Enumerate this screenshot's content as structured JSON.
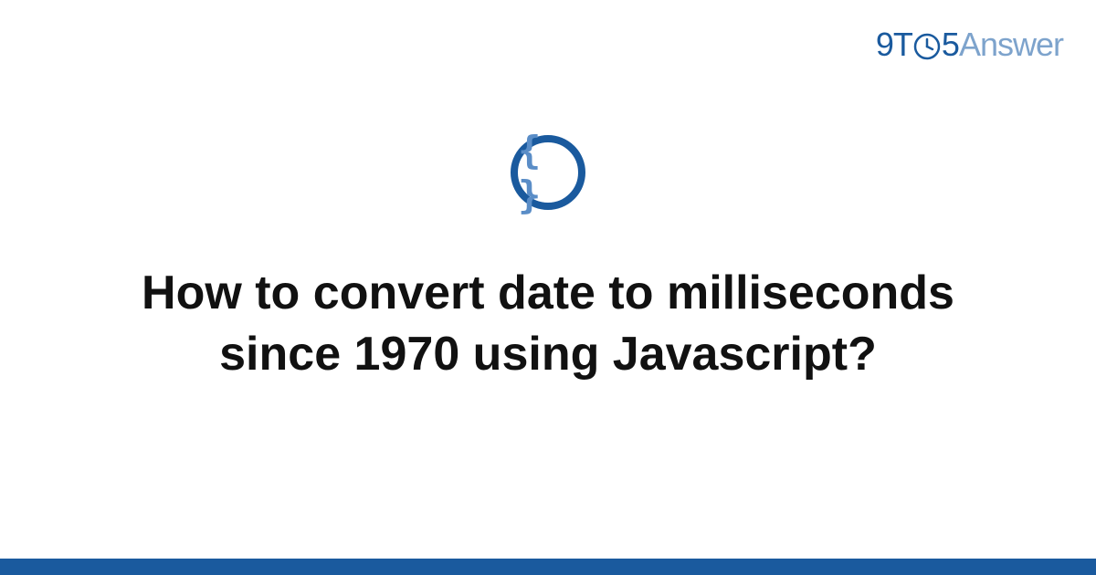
{
  "brand": {
    "part_9": "9",
    "part_t": "T",
    "part_5": "5",
    "part_answer": "Answer"
  },
  "icon": {
    "braces": "{ }"
  },
  "title": "How to convert date to milliseconds since 1970 using Javascript?",
  "colors": {
    "brand_primary": "#1a5a9e",
    "brand_secondary": "#7da3cc",
    "brace_color": "#5a8dc7",
    "text_color": "#111111",
    "footer_bar": "#1a5a9e"
  }
}
